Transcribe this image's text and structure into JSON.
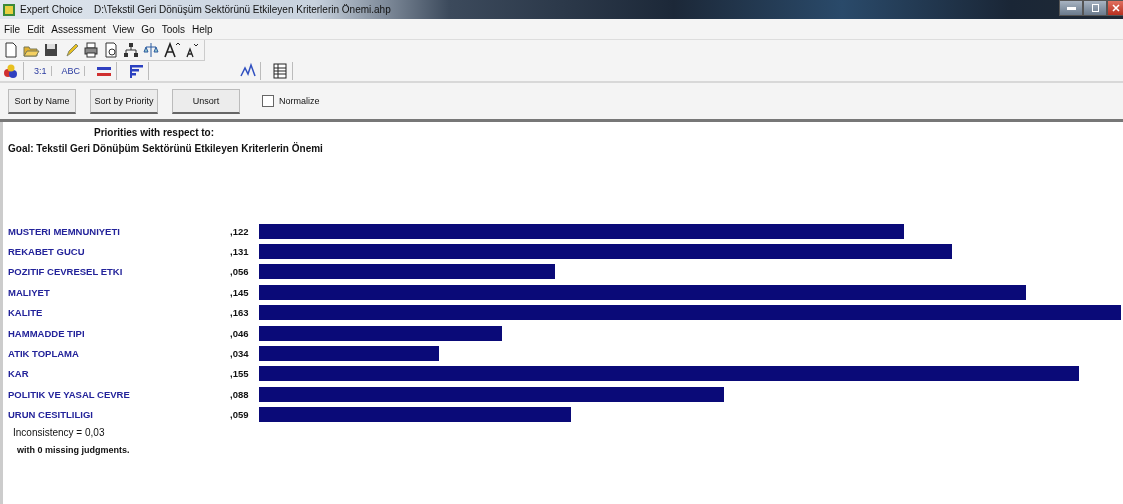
{
  "window": {
    "title": "Expert Choice    D:\\Tekstil Geri Dönüşüm Sektörünü Etkileyen Kriterlerin Önemi.ahp"
  },
  "menu": [
    "File",
    "Edit",
    "Assessment",
    "View",
    "Go",
    "Tools",
    "Help"
  ],
  "toolbar2": [
    {
      "kind": "icon"
    },
    {
      "kind": "text",
      "label": "3:1"
    },
    {
      "kind": "text",
      "label": "ABC"
    },
    {
      "kind": "icon"
    },
    {
      "kind": "icon"
    },
    {
      "kind": "gap"
    },
    {
      "kind": "icon"
    },
    {
      "kind": "icon"
    }
  ],
  "buttons": [
    "Sort by Name",
    "Sort by Priority",
    "Unsort"
  ],
  "normalize": {
    "label": "Normalize",
    "checked": false
  },
  "heading": "Priorities with respect to:",
  "goal": "Goal: Tekstil Geri Dönüþüm Sektörünü Etkileyen Kriterlerin Önemi",
  "rows": [
    {
      "name": "MUSTERI MEMNUNIYETI",
      "value": ",122"
    },
    {
      "name": "REKABET GUCU",
      "value": ",131"
    },
    {
      "name": "POZITIF CEVRESEL ETKI",
      "value": ",056"
    },
    {
      "name": "MALIYET",
      "value": ",145"
    },
    {
      "name": "KALITE",
      "value": ",163"
    },
    {
      "name": "HAMMADDE TIPI",
      "value": ",046"
    },
    {
      "name": "ATIK TOPLAMA",
      "value": ",034"
    },
    {
      "name": "KAR",
      "value": ",155"
    },
    {
      "name": "POLITIK VE YASAL CEVRE",
      "value": ",088"
    },
    {
      "name": "URUN CESITLILIGI",
      "value": ",059"
    }
  ],
  "inconsistency": "Inconsistency = 0,03",
  "missing": "with 0  missing judgments."
}
